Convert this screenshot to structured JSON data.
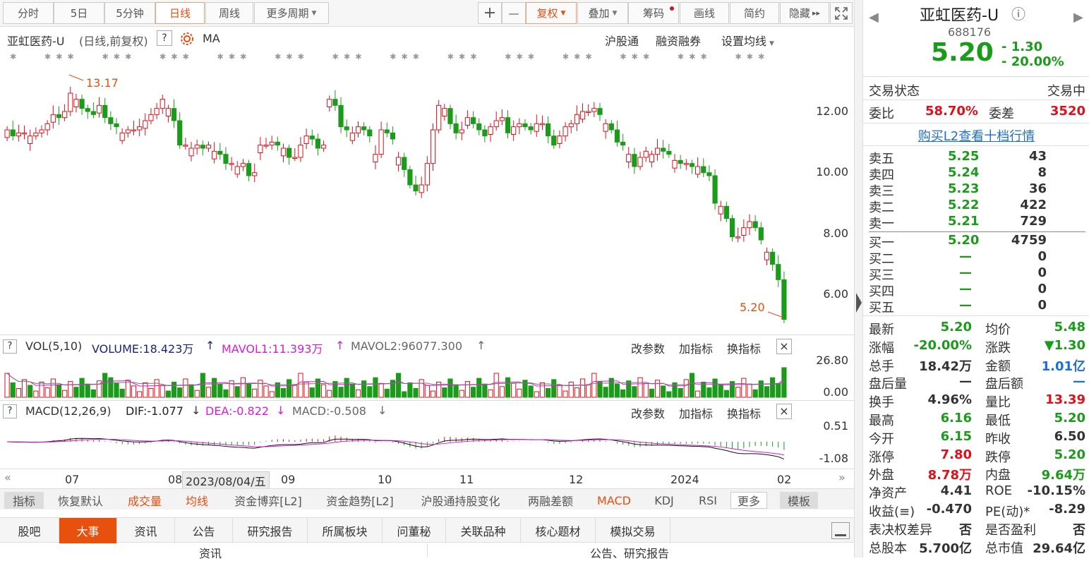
{
  "toolbar": {
    "tabs": [
      "分时",
      "5日",
      "5分钟",
      "日线",
      "周线",
      "更多周期"
    ],
    "active_tab": "日线",
    "plus": "+",
    "minus": "—",
    "fuquan": "复权",
    "overlay": "叠加",
    "chips": "筹码",
    "draw": "画线",
    "simple": "简约",
    "hide": "隐藏",
    "hide_arrows": "▸▸"
  },
  "chart_header": {
    "title": "亚虹医药-U",
    "sub": "(日线,前复权)",
    "help": "?",
    "ma": "MA",
    "links": [
      "沪股通",
      "融资融券",
      "设置均线"
    ]
  },
  "chart_data": [
    {
      "type": "candlestick",
      "title": "亚虹医药-U (日线,前复权)",
      "x_labels": [
        "07",
        "08",
        "09",
        "10",
        "11",
        "12",
        "2024",
        "02"
      ],
      "y_ticks": [
        "12.00",
        "10.00",
        "8.00",
        "6.00"
      ],
      "ylim": [
        4.9,
        14.0
      ],
      "annotations": [
        {
          "label": "13.17",
          "kind": "high"
        },
        {
          "label": "5.20",
          "kind": "last"
        }
      ],
      "cursor_date": "2023/08/04/五",
      "series": [
        {
          "name": "close",
          "values": [
            11.4,
            11.2,
            11.3,
            11.3,
            11.2,
            11.3,
            11.4,
            11.6,
            11.9,
            11.8,
            12.0,
            12.6,
            12.4,
            12.1,
            12.0,
            11.9,
            12.2,
            11.8,
            11.6,
            11.5,
            11.3,
            11.4,
            11.4,
            11.5,
            11.7,
            11.9,
            12.1,
            12.4,
            12.1,
            11.7,
            10.9,
            10.9,
            10.8,
            10.9,
            10.8,
            10.9,
            10.7,
            10.6,
            10.3,
            10.3,
            10.2,
            10.3,
            9.9,
            10.0,
            10.9,
            10.9,
            11.0,
            10.9,
            10.8,
            10.5,
            10.5,
            10.9,
            11.2,
            11.1,
            10.8,
            10.9,
            12.4,
            12.2,
            11.5,
            11.4,
            11.3,
            11.5,
            11.4,
            11.2,
            10.6,
            11.4,
            11.3,
            11.1,
            10.5,
            10.1,
            9.6,
            9.4,
            9.6,
            10.3,
            11.4,
            12.2,
            12.1,
            11.6,
            11.3,
            11.4,
            11.8,
            11.6,
            11.4,
            11.2,
            11.5,
            11.7,
            11.8,
            11.3,
            11.5,
            11.6,
            11.5,
            11.4,
            11.6,
            11.6,
            11.2,
            10.9,
            11.2,
            11.5,
            11.6,
            11.9,
            12.0,
            12.0,
            12.1,
            11.9,
            11.6,
            11.4,
            11.0,
            10.9,
            10.6,
            10.2,
            10.5,
            10.7,
            10.6,
            10.8,
            10.7,
            10.6,
            10.4,
            10.3,
            10.3,
            10.2,
            10.2,
            10.0,
            9.9,
            9.0,
            8.9,
            8.5,
            7.9,
            7.9,
            8.2,
            8.4,
            8.2,
            7.8,
            7.4,
            7.0,
            6.5,
            5.2
          ]
        }
      ]
    },
    {
      "type": "bar",
      "title": "VOL(5,10)",
      "y_ticks": [
        "26.80",
        "0.00"
      ],
      "series": [
        {
          "name": "VOLUME",
          "label": "VOLUME:18.423万"
        },
        {
          "name": "MAVOL1",
          "label": "MAVOL1:11.393万"
        },
        {
          "name": "MAVOL2",
          "label": "MAVOL2:96077.300"
        }
      ],
      "last_volume_wan": 18.423
    },
    {
      "type": "line",
      "title": "MACD(12,26,9)",
      "y_ticks": [
        "0.51",
        "-1.08"
      ],
      "series": [
        {
          "name": "DIF",
          "last": -1.077
        },
        {
          "name": "DEA",
          "last": -0.822
        },
        {
          "name": "MACD",
          "last": -0.508
        }
      ]
    }
  ],
  "vol_panel": {
    "help": "?",
    "title": "VOL(5,10)",
    "volume": "VOLUME:18.423万",
    "mavol1": "MAVOL1:11.393万",
    "mavol2": "MAVOL2:96077.300",
    "arrow_up": "↑",
    "links": [
      "改参数",
      "加指标",
      "换指标"
    ],
    "close": "×",
    "ymax": "26.80",
    "ymin": "0.00"
  },
  "macd_panel": {
    "help": "?",
    "title": "MACD(12,26,9)",
    "dif": "DIF:-1.077",
    "dea": "DEA:-0.822",
    "macd": "MACD:-0.508",
    "arrow_down": "↓",
    "links": [
      "改参数",
      "加指标",
      "换指标"
    ],
    "close": "×",
    "ymax": "0.51",
    "ymin": "-1.08"
  },
  "nav": {
    "left": "«",
    "right": "»"
  },
  "indicators": [
    "指标",
    "恢复默认",
    "成交量",
    "均线",
    "资金博弈[L2]",
    "资金趋势[L2]",
    "沪股通持股变化",
    "两融差额",
    "MACD",
    "KDJ",
    "RSI",
    "更多",
    "模板"
  ],
  "bottom_tabs": [
    "股吧",
    "大事",
    "资讯",
    "公告",
    "研究报告",
    "所属板块",
    "问董秘",
    "关联品种",
    "核心题材",
    "模拟交易"
  ],
  "active_bottom_tab": "大事",
  "content_headers": [
    "资讯",
    "公告、研究报告"
  ],
  "colors": {
    "up": "#e0101a",
    "down": "#1a9c1a",
    "accent": "#e84e0e",
    "link": "#1e6fd0"
  },
  "quote": {
    "name": "亚虹医药-U",
    "info": "ⓘ",
    "code": "688176",
    "price": "5.20",
    "change": "- 1.30",
    "pct": "- 20.00%",
    "nav_prev": "◀",
    "nav_next": "▶",
    "status_label": "交易状态",
    "status": "交易中",
    "weibi_label": "委比",
    "weibi": "58.70%",
    "weicha_label": "委差",
    "weicha": "3520",
    "l2_link": "购买L2查看十档行情",
    "asks": [
      {
        "label": "卖五",
        "price": "5.25",
        "vol": "43"
      },
      {
        "label": "卖四",
        "price": "5.24",
        "vol": "8"
      },
      {
        "label": "卖三",
        "price": "5.23",
        "vol": "36"
      },
      {
        "label": "卖二",
        "price": "5.22",
        "vol": "422"
      },
      {
        "label": "卖一",
        "price": "5.21",
        "vol": "729"
      }
    ],
    "bids": [
      {
        "label": "买一",
        "price": "5.20",
        "vol": "4759"
      },
      {
        "label": "买二",
        "price": "—",
        "vol": "0"
      },
      {
        "label": "买三",
        "price": "—",
        "vol": "0"
      },
      {
        "label": "买四",
        "price": "—",
        "vol": "0"
      },
      {
        "label": "买五",
        "price": "—",
        "vol": "0"
      }
    ],
    "stats": [
      {
        "l1": "最新",
        "v1": "5.20",
        "c1": "green",
        "l2": "均价",
        "v2": "5.48",
        "c2": "green"
      },
      {
        "l1": "涨幅",
        "v1": "-20.00%",
        "c1": "green",
        "l2": "涨跌",
        "v2": "▼1.30",
        "c2": "green"
      },
      {
        "l1": "总手",
        "v1": "18.42万",
        "c1": "",
        "l2": "金额",
        "v2": "1.01亿",
        "c2": "blue"
      },
      {
        "l1": "盘后量",
        "v1": "—",
        "c1": "",
        "l2": "盘后额",
        "v2": "—",
        "c2": "blue"
      },
      {
        "l1": "换手",
        "v1": "4.96%",
        "c1": "",
        "l2": "量比",
        "v2": "13.39",
        "c2": "red"
      },
      {
        "l1": "最高",
        "v1": "6.16",
        "c1": "green",
        "l2": "最低",
        "v2": "5.20",
        "c2": "green"
      },
      {
        "l1": "今开",
        "v1": "6.15",
        "c1": "green",
        "l2": "昨收",
        "v2": "6.50",
        "c2": ""
      },
      {
        "l1": "涨停",
        "v1": "7.80",
        "c1": "red",
        "l2": "跌停",
        "v2": "5.20",
        "c2": "green"
      },
      {
        "l1": "外盘",
        "v1": "8.78万",
        "c1": "red",
        "l2": "内盘",
        "v2": "9.64万",
        "c2": "green"
      },
      {
        "l1": "净资产",
        "v1": "4.41",
        "c1": "",
        "l2": "ROE",
        "v2": "-10.15%",
        "c2": ""
      },
      {
        "l1": "收益(≡)",
        "v1": "-0.470",
        "c1": "",
        "l2": "PE(动)*",
        "v2": "-8.29",
        "c2": ""
      },
      {
        "l1": "表决权差异",
        "v1": "否",
        "c1": "",
        "l2": "是否盈利",
        "v2": "否",
        "c2": ""
      },
      {
        "l1": "总股本",
        "v1": "5.700亿",
        "c1": "",
        "l2": "总市值",
        "v2": "29.64亿",
        "c2": ""
      }
    ]
  }
}
